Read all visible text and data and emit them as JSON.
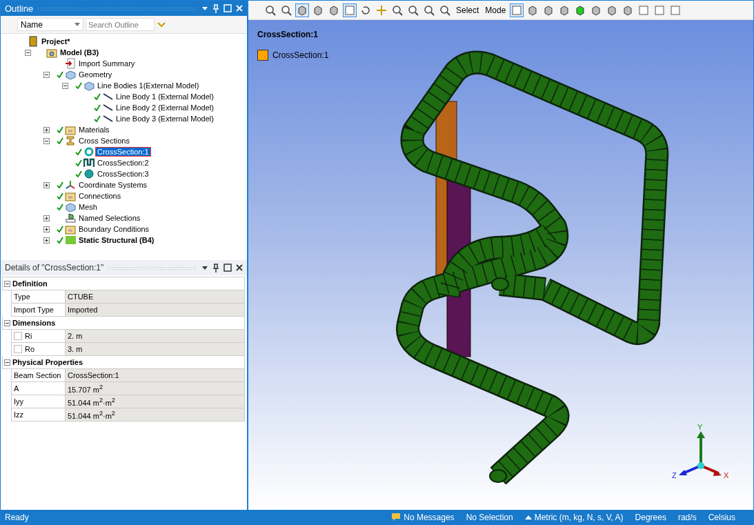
{
  "outline": {
    "title": "Outline",
    "name_filter": "Name",
    "search": {
      "placeholder": "Search Outline"
    }
  },
  "tree": [
    {
      "label": "Project*",
      "kind": "project",
      "bold": true,
      "children": [
        {
          "label": "Model (B3)",
          "kind": "model",
          "bold": true,
          "expanded": true,
          "children": [
            {
              "label": "Import Summary",
              "kind": "import",
              "checked": false
            },
            {
              "label": "Geometry",
              "kind": "geometry",
              "checked": true,
              "expanded": true,
              "children": [
                {
                  "label": "Line Bodies 1(External Model)",
                  "kind": "geometry",
                  "checked": true,
                  "expanded": true,
                  "children": [
                    {
                      "label": "Line Body 1 (External Model)",
                      "kind": "line",
                      "checked": true
                    },
                    {
                      "label": "Line Body 2 (External Model)",
                      "kind": "line",
                      "checked": true
                    },
                    {
                      "label": "Line Body 3 (External Model)",
                      "kind": "line",
                      "checked": true
                    }
                  ]
                }
              ]
            },
            {
              "label": "Materials",
              "kind": "folder",
              "checked": true,
              "expanded": false
            },
            {
              "label": "Cross Sections",
              "kind": "beam",
              "checked": true,
              "expanded": true,
              "children": [
                {
                  "label": "CrossSection:1",
                  "kind": "ring",
                  "checked": true,
                  "selected": true
                },
                {
                  "label": "CrossSection:2",
                  "kind": "channel",
                  "checked": true,
                  "selected": false
                },
                {
                  "label": "CrossSection:3",
                  "kind": "disk",
                  "checked": true,
                  "selected": false
                }
              ]
            },
            {
              "label": "Coordinate Systems",
              "kind": "axes",
              "checked": true,
              "expanded": false
            },
            {
              "label": "Connections",
              "kind": "folder",
              "checked": true
            },
            {
              "label": "Mesh",
              "kind": "geometry",
              "checked": true
            },
            {
              "label": "Named Selections",
              "kind": "named",
              "checked": false,
              "expanded": false
            },
            {
              "label": "Boundary Conditions",
              "kind": "folder",
              "checked": true,
              "expanded": false
            },
            {
              "label": "Static Structural (B4)",
              "kind": "static",
              "bold": true,
              "checked": true,
              "expanded": false
            }
          ]
        }
      ]
    }
  ],
  "details": {
    "title": "Details of \"CrossSection:1\"",
    "groups": [
      {
        "title": "Definition",
        "expanded": true,
        "rows": [
          {
            "label": "Type",
            "value": "CTUBE"
          },
          {
            "label": "Import Type",
            "value": "Imported"
          }
        ]
      },
      {
        "title": "Dimensions",
        "expanded": true,
        "rows": [
          {
            "label": "Ri",
            "value": "2. m",
            "checked": false
          },
          {
            "label": "Ro",
            "value": "3. m",
            "checked": false
          }
        ]
      },
      {
        "title": "Physical Properties",
        "expanded": true,
        "rows": [
          {
            "label": "Beam Section",
            "value": "CrossSection:1"
          },
          {
            "label": "A",
            "value": "15.707 m$^{2}$"
          },
          {
            "label": "Iyy",
            "value": "51.044 m$^{2}$·m$^{2}$"
          },
          {
            "label": "Izz",
            "value": "51.044 m$^{2}$·m$^{2}$"
          }
        ]
      }
    ]
  },
  "toolbar": [
    {
      "kind": "icon",
      "selected": false
    },
    {
      "kind": "icon",
      "selected": false
    },
    {
      "kind": "icon",
      "selected": true
    },
    {
      "kind": "icon",
      "selected": false
    },
    {
      "kind": "icon",
      "selected": false
    },
    {
      "kind": "icon",
      "selected": true
    },
    {
      "kind": "icon",
      "selected": false
    },
    {
      "kind": "icon",
      "selected": false
    },
    {
      "kind": "icon",
      "selected": false
    },
    {
      "kind": "icon",
      "selected": false
    },
    {
      "kind": "icon",
      "selected": false
    },
    {
      "kind": "icon",
      "selected": false
    },
    {
      "kind": "text",
      "label": "Select"
    },
    {
      "kind": "text",
      "label": "Mode"
    },
    {
      "kind": "icon",
      "selected": true
    },
    {
      "kind": "icon",
      "selected": false
    },
    {
      "kind": "icon",
      "selected": false
    },
    {
      "kind": "icon",
      "selected": false
    },
    {
      "kind": "icon",
      "selected": false
    },
    {
      "kind": "icon",
      "selected": false
    },
    {
      "kind": "icon",
      "selected": false
    },
    {
      "kind": "icon",
      "selected": false
    },
    {
      "kind": "icon",
      "selected": false
    },
    {
      "kind": "icon",
      "selected": false
    },
    {
      "kind": "icon",
      "selected": false
    }
  ],
  "viewport": {
    "title": "CrossSection:1",
    "legend": [
      {
        "label": "CrossSection:1",
        "color": "#ffa500"
      }
    ],
    "axes": {
      "y": "Y",
      "x": "X",
      "z": "Z"
    }
  },
  "status_bar": {
    "left": "Ready",
    "items": [
      {
        "kind": "messages",
        "label": "No Messages"
      },
      {
        "kind": "plain",
        "label": "No Selection"
      },
      {
        "kind": "units",
        "label": "Metric (m, kg, N, s, V, A)"
      },
      {
        "kind": "plain",
        "label": "Degrees"
      },
      {
        "kind": "plain",
        "label": "rad/s"
      },
      {
        "kind": "plain",
        "label": "Celsius"
      }
    ]
  }
}
